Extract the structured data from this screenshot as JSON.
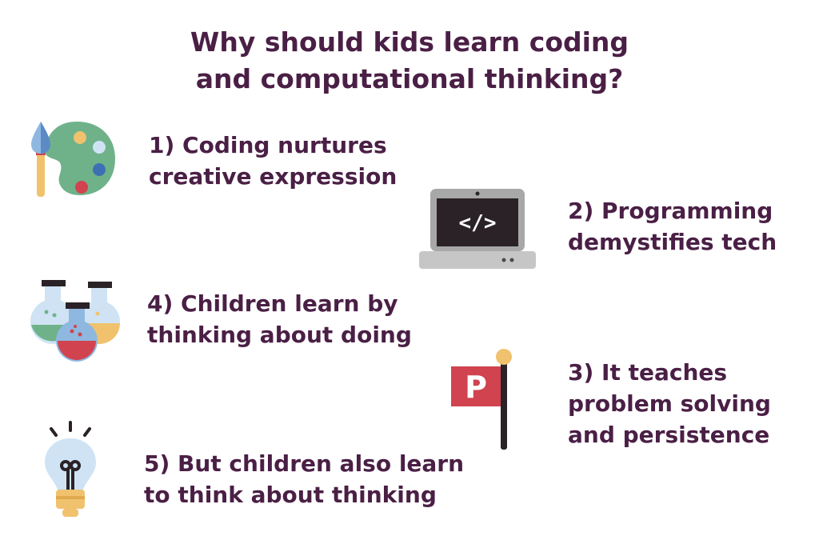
{
  "title": {
    "line1": "Why should kids learn coding",
    "line2": "and computational thinking?"
  },
  "items": [
    {
      "line1": "1) Coding nurtures",
      "line2": "creative expression",
      "icon": "paint-palette-icon"
    },
    {
      "line1": "2) Programming",
      "line2": "demystifies tech",
      "icon": "laptop-code-icon"
    },
    {
      "line1": "3) It teaches",
      "line2": "problem solving",
      "line3": "and persistence",
      "icon": "flag-icon"
    },
    {
      "line1": "4) Children learn by",
      "line2": "thinking about doing",
      "icon": "lab-flasks-icon"
    },
    {
      "line1": "5) But children also learn",
      "line2": "to think about thinking",
      "icon": "light-bulb-icon"
    }
  ],
  "laptop_screen_text": "</>",
  "flag_letter": "P",
  "colors": {
    "text": "#4a1f45",
    "palette": "#6fb28a",
    "laptop_body": "#a8a8a8",
    "laptop_screen": "#2a2226",
    "flag": "#d0434f",
    "bulb": "#cfe3f5",
    "accent_yellow": "#f0c26e"
  }
}
